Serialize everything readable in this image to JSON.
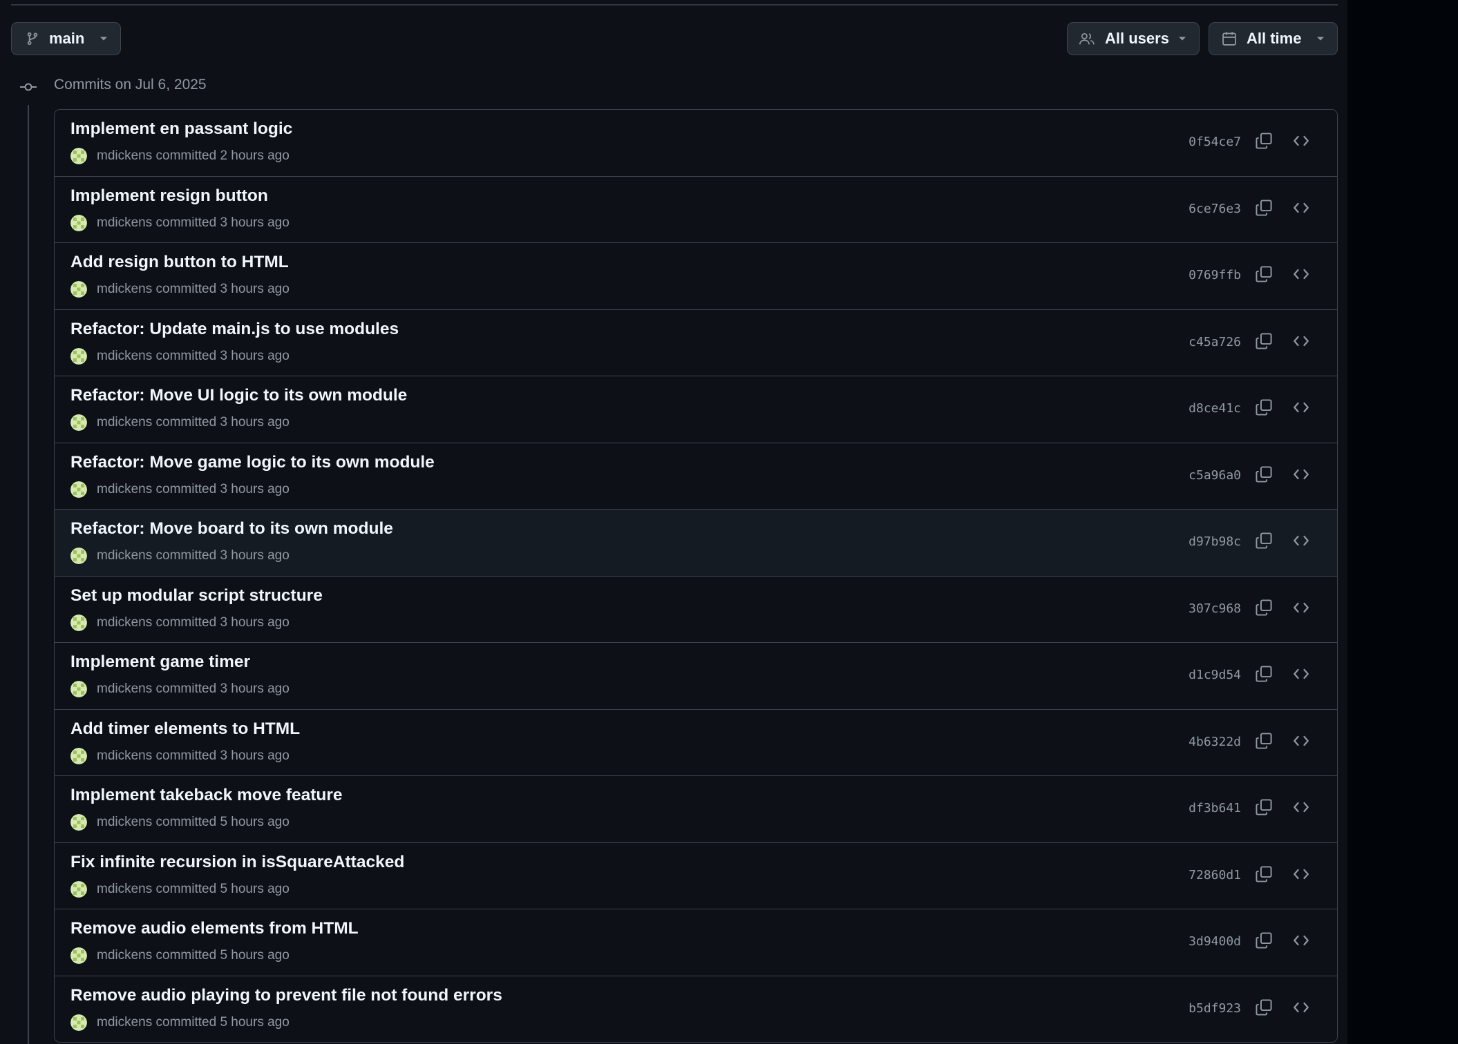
{
  "toolbar": {
    "branch_label": "main",
    "users_label": "All users",
    "time_label": "All time"
  },
  "commit_group": {
    "date_heading": "Commits on Jul 6, 2025"
  },
  "colors": {
    "background": "#0d1117",
    "border": "#3d444d",
    "text_primary": "#f0f6fc",
    "text_muted": "#9198a1",
    "row_hover": "#151b23"
  },
  "icons": {
    "branch": "git-branch-icon",
    "users": "people-icon",
    "time": "calendar-icon",
    "commit": "git-commit-icon",
    "copy": "copy-icon",
    "browse": "code-icon"
  },
  "commits": [
    {
      "title": "Implement en passant logic",
      "author": "mdickens",
      "verb": "committed",
      "time": "2 hours ago",
      "sha": "0f54ce7"
    },
    {
      "title": "Implement resign button",
      "author": "mdickens",
      "verb": "committed",
      "time": "3 hours ago",
      "sha": "6ce76e3"
    },
    {
      "title": "Add resign button to HTML",
      "author": "mdickens",
      "verb": "committed",
      "time": "3 hours ago",
      "sha": "0769ffb"
    },
    {
      "title": "Refactor: Update main.js to use modules",
      "author": "mdickens",
      "verb": "committed",
      "time": "3 hours ago",
      "sha": "c45a726"
    },
    {
      "title": "Refactor: Move UI logic to its own module",
      "author": "mdickens",
      "verb": "committed",
      "time": "3 hours ago",
      "sha": "d8ce41c"
    },
    {
      "title": "Refactor: Move game logic to its own module",
      "author": "mdickens",
      "verb": "committed",
      "time": "3 hours ago",
      "sha": "c5a96a0"
    },
    {
      "title": "Refactor: Move board to its own module",
      "author": "mdickens",
      "verb": "committed",
      "time": "3 hours ago",
      "sha": "d97b98c"
    },
    {
      "title": "Set up modular script structure",
      "author": "mdickens",
      "verb": "committed",
      "time": "3 hours ago",
      "sha": "307c968"
    },
    {
      "title": "Implement game timer",
      "author": "mdickens",
      "verb": "committed",
      "time": "3 hours ago",
      "sha": "d1c9d54"
    },
    {
      "title": "Add timer elements to HTML",
      "author": "mdickens",
      "verb": "committed",
      "time": "3 hours ago",
      "sha": "4b6322d"
    },
    {
      "title": "Implement takeback move feature",
      "author": "mdickens",
      "verb": "committed",
      "time": "5 hours ago",
      "sha": "df3b641"
    },
    {
      "title": "Fix infinite recursion in isSquareAttacked",
      "author": "mdickens",
      "verb": "committed",
      "time": "5 hours ago",
      "sha": "72860d1"
    },
    {
      "title": "Remove audio elements from HTML",
      "author": "mdickens",
      "verb": "committed",
      "time": "5 hours ago",
      "sha": "3d9400d"
    },
    {
      "title": "Remove audio playing to prevent file not found errors",
      "author": "mdickens",
      "verb": "committed",
      "time": "5 hours ago",
      "sha": "b5df923"
    }
  ]
}
